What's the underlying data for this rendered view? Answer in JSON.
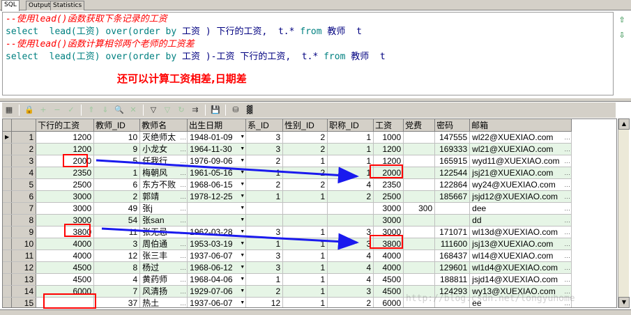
{
  "tabs": [
    {
      "label": "SQL",
      "active": true
    },
    {
      "label": "Output",
      "active": false
    },
    {
      "label": "Statistics",
      "active": false
    }
  ],
  "editor": {
    "line1_comment": "--使用lead()函数获取下条记录的工资",
    "line2": {
      "kw1": "select",
      "fn1": "lead(工资)",
      "kw2": "over",
      "p1": "(",
      "kw3": "order by",
      "rest": " 工资 ) 下行的工资,  t.* ",
      "kw4": "from",
      "tail": " 教师  t"
    },
    "line3_comment": "--使用lead()函数计算相邻两个老师的工资差",
    "line4": {
      "kw1": "select",
      "fn1": "lead(工资)",
      "kw2": "over",
      "p1": "(",
      "kw3": "order by",
      "rest": " 工资 )-工资 下行的工资,  t.* ",
      "kw4": "from",
      "tail": " 教师  t"
    },
    "note": "还可以计算工资相差,日期差"
  },
  "grid": {
    "columns": [
      "下行的工资",
      "教师_ID",
      "教师名",
      "出生日期",
      "系_ID",
      "性别_ID",
      "职称_ID",
      "工资",
      "党费",
      "密码",
      "邮箱"
    ],
    "rows": [
      [
        "1200",
        "10",
        "灭绝师太",
        "1948-01-09",
        "3",
        "2",
        "1",
        "1000",
        "",
        "147555",
        "wl22@XUEXIAO.com"
      ],
      [
        "1200",
        "9",
        "小龙女",
        "1964-11-30",
        "3",
        "2",
        "1",
        "1200",
        "",
        "169333",
        "wl21@XUEXIAO.com"
      ],
      [
        "2000",
        "5",
        "任我行",
        "1976-09-06",
        "2",
        "1",
        "1",
        "1200",
        "",
        "165915",
        "wyd11@XUEXIAO.com"
      ],
      [
        "2350",
        "1",
        "梅朝风",
        "1961-05-16",
        "1",
        "2",
        "1",
        "2000",
        "",
        "122544",
        "jsj21@XUEXIAO.com"
      ],
      [
        "2500",
        "6",
        "东方不败",
        "1968-06-15",
        "2",
        "2",
        "4",
        "2350",
        "",
        "122864",
        "wy24@XUEXIAO.com"
      ],
      [
        "3000",
        "2",
        "郭靖",
        "1978-12-25",
        "1",
        "1",
        "2",
        "2500",
        "",
        "185667",
        "jsjd12@XUEXIAO.com"
      ],
      [
        "3000",
        "49",
        "张j",
        "",
        "",
        "",
        "",
        "3000",
        "300",
        "",
        "dee"
      ],
      [
        "3000",
        "54",
        "张san",
        "",
        "",
        "",
        "",
        "3000",
        "",
        "",
        "dd"
      ],
      [
        "3800",
        "11",
        "张无忌",
        "1962-03-28",
        "3",
        "1",
        "3",
        "3000",
        "",
        "171071",
        "wl13d@XUEXIAO.com"
      ],
      [
        "4000",
        "3",
        "周伯通",
        "1953-03-19",
        "1",
        "1",
        "3",
        "3800",
        "",
        "111600",
        "jsj13@XUEXIAO.com"
      ],
      [
        "4000",
        "12",
        "张三丰",
        "1937-06-07",
        "3",
        "1",
        "4",
        "4000",
        "",
        "168437",
        "wl14@XUEXIAO.com"
      ],
      [
        "4500",
        "8",
        "杨过",
        "1968-06-12",
        "3",
        "1",
        "4",
        "4000",
        "",
        "129601",
        "wl1d4@XUEXIAO.com"
      ],
      [
        "4500",
        "4",
        "黄药师",
        "1968-04-06",
        "1",
        "1",
        "4",
        "4500",
        "",
        "188811",
        "jsjd14@XUEXIAO.com"
      ],
      [
        "6000",
        "7",
        "风清扬",
        "1929-07-06",
        "2",
        "1",
        "3",
        "4500",
        "",
        "124293",
        "wy13@XUEXIAO.com"
      ],
      [
        "",
        "37",
        "热土",
        "1937-06-07",
        "12",
        "1",
        "2",
        "6000",
        "",
        "",
        "ee"
      ]
    ]
  },
  "watermark": "http://blog.csdn.net/longyuhome",
  "colors": {
    "accent_red": "#ff0000",
    "arrow_blue": "#1a1aee",
    "row_alt": "#e6f5e6"
  }
}
